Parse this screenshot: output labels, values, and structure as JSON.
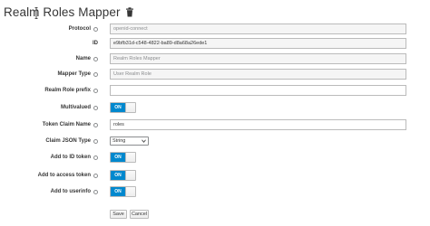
{
  "header": {
    "title": "Realm Roles Mapper",
    "delete_icon": "trash-icon"
  },
  "form": {
    "protocol": {
      "label": "Protocol",
      "value": "openid-connect"
    },
    "id": {
      "label": "ID",
      "value": "e9bfb31d-c548-4822-ba89-d8a68a26ede1"
    },
    "name": {
      "label": "Name",
      "value": "Realm Roles Mapper"
    },
    "mapper_type": {
      "label": "Mapper Type",
      "value": "User Realm Role"
    },
    "realm_role_prefix": {
      "label": "Realm Role prefix",
      "value": ""
    },
    "multivalued": {
      "label": "Multivalued",
      "state": "ON"
    },
    "token_claim_name": {
      "label": "Token Claim Name",
      "value": "roles"
    },
    "claim_json_type": {
      "label": "Claim JSON Type",
      "value": "String"
    },
    "add_to_id_token": {
      "label": "Add to ID token",
      "state": "ON"
    },
    "add_to_access_token": {
      "label": "Add to access token",
      "state": "ON"
    },
    "add_to_userinfo": {
      "label": "Add to userinfo",
      "state": "ON"
    }
  },
  "actions": {
    "save_label": "Save",
    "cancel_label": "Cancel"
  },
  "colors": {
    "accent": "#0088ce",
    "text": "#363636",
    "border": "#bbbbbb"
  }
}
